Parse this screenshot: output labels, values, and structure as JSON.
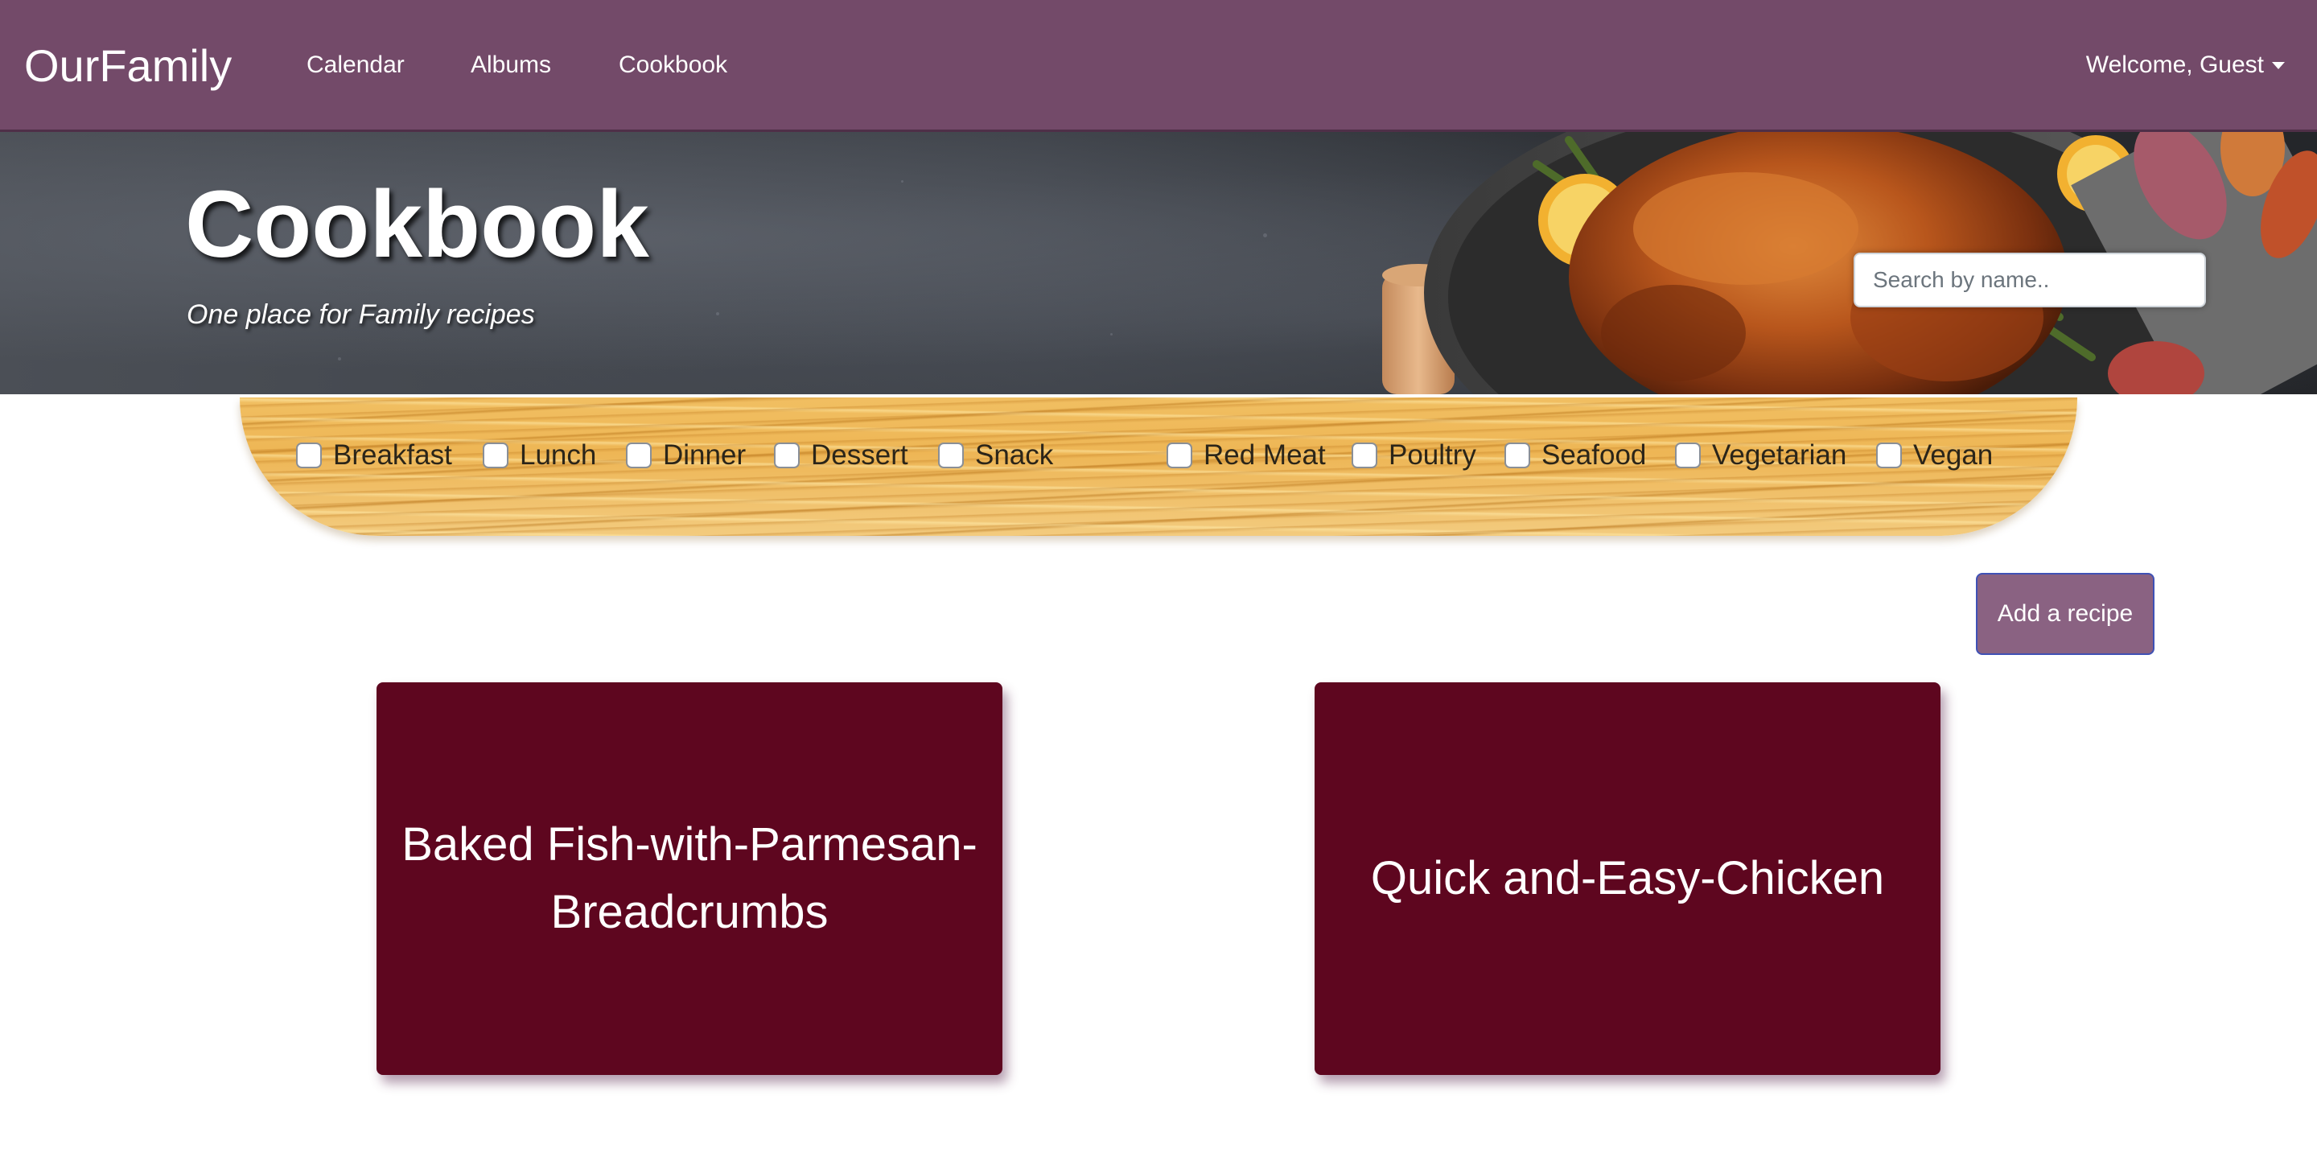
{
  "navbar": {
    "brand": "OurFamily",
    "links": [
      "Calendar",
      "Albums",
      "Cookbook"
    ],
    "user_menu": "Welcome, Guest"
  },
  "hero": {
    "title": "Cookbook",
    "subtitle": "One place for Family recipes",
    "search_placeholder": "Search by name.."
  },
  "filters": {
    "meal_types": [
      "Breakfast",
      "Lunch",
      "Dinner",
      "Dessert",
      "Snack"
    ],
    "categories": [
      "Red Meat",
      "Poultry",
      "Seafood",
      "Vegetarian",
      "Vegan"
    ]
  },
  "actions": {
    "add_recipe": "Add a recipe"
  },
  "recipes": [
    {
      "title": "Baked Fish-with-Parmesan-Breadcrumbs"
    },
    {
      "title": "Quick and-Easy-Chicken"
    }
  ],
  "colors": {
    "navbar": "#734a69",
    "card": "#5e061f",
    "button": "#8a6282"
  }
}
